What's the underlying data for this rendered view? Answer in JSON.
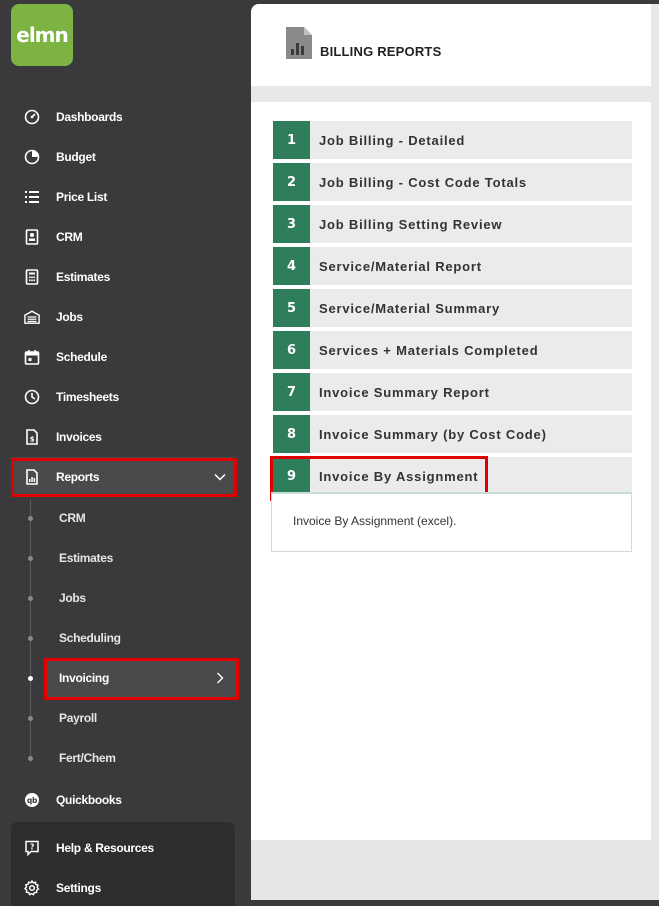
{
  "app": {
    "logo_text": "elmn",
    "brand_color": "#7cb342",
    "accent_color": "#2e7d5b",
    "highlight_color": "#e00000"
  },
  "sidebar": {
    "items": [
      {
        "label": "Dashboards",
        "icon": "gauge-icon"
      },
      {
        "label": "Budget",
        "icon": "pie-chart-icon"
      },
      {
        "label": "Price List",
        "icon": "list-icon"
      },
      {
        "label": "CRM",
        "icon": "contact-card-icon"
      },
      {
        "label": "Estimates",
        "icon": "calculator-icon"
      },
      {
        "label": "Jobs",
        "icon": "garage-icon"
      },
      {
        "label": "Schedule",
        "icon": "calendar-icon"
      },
      {
        "label": "Timesheets",
        "icon": "clock-icon"
      },
      {
        "label": "Invoices",
        "icon": "invoice-icon"
      },
      {
        "label": "Reports",
        "icon": "report-icon",
        "expanded": true
      }
    ],
    "report_subitems": [
      {
        "label": "CRM"
      },
      {
        "label": "Estimates"
      },
      {
        "label": "Jobs"
      },
      {
        "label": "Scheduling"
      },
      {
        "label": "Invoicing",
        "active": true
      },
      {
        "label": "Payroll"
      },
      {
        "label": "Fert/Chem"
      }
    ],
    "after_items": [
      {
        "label": "Quickbooks",
        "icon": "quickbooks-icon"
      }
    ],
    "bottom_items": [
      {
        "label": "Help & Resources",
        "icon": "help-icon"
      },
      {
        "label": "Settings",
        "icon": "gear-icon"
      }
    ]
  },
  "main": {
    "title": "BILLING REPORTS",
    "reports": [
      {
        "num": "1",
        "label": "Job Billing - Detailed"
      },
      {
        "num": "2",
        "label": "Job Billing - Cost Code Totals"
      },
      {
        "num": "3",
        "label": "Job Billing Setting Review"
      },
      {
        "num": "4",
        "label": "Service/Material Report"
      },
      {
        "num": "5",
        "label": "Service/Material Summary"
      },
      {
        "num": "6",
        "label": "Services + Materials Completed"
      },
      {
        "num": "7",
        "label": "Invoice Summary Report"
      },
      {
        "num": "8",
        "label": "Invoice Summary (by Cost Code)"
      },
      {
        "num": "9",
        "label": "Invoice By Assignment",
        "selected": true
      }
    ],
    "selected_description": "Invoice By Assignment (excel)."
  }
}
